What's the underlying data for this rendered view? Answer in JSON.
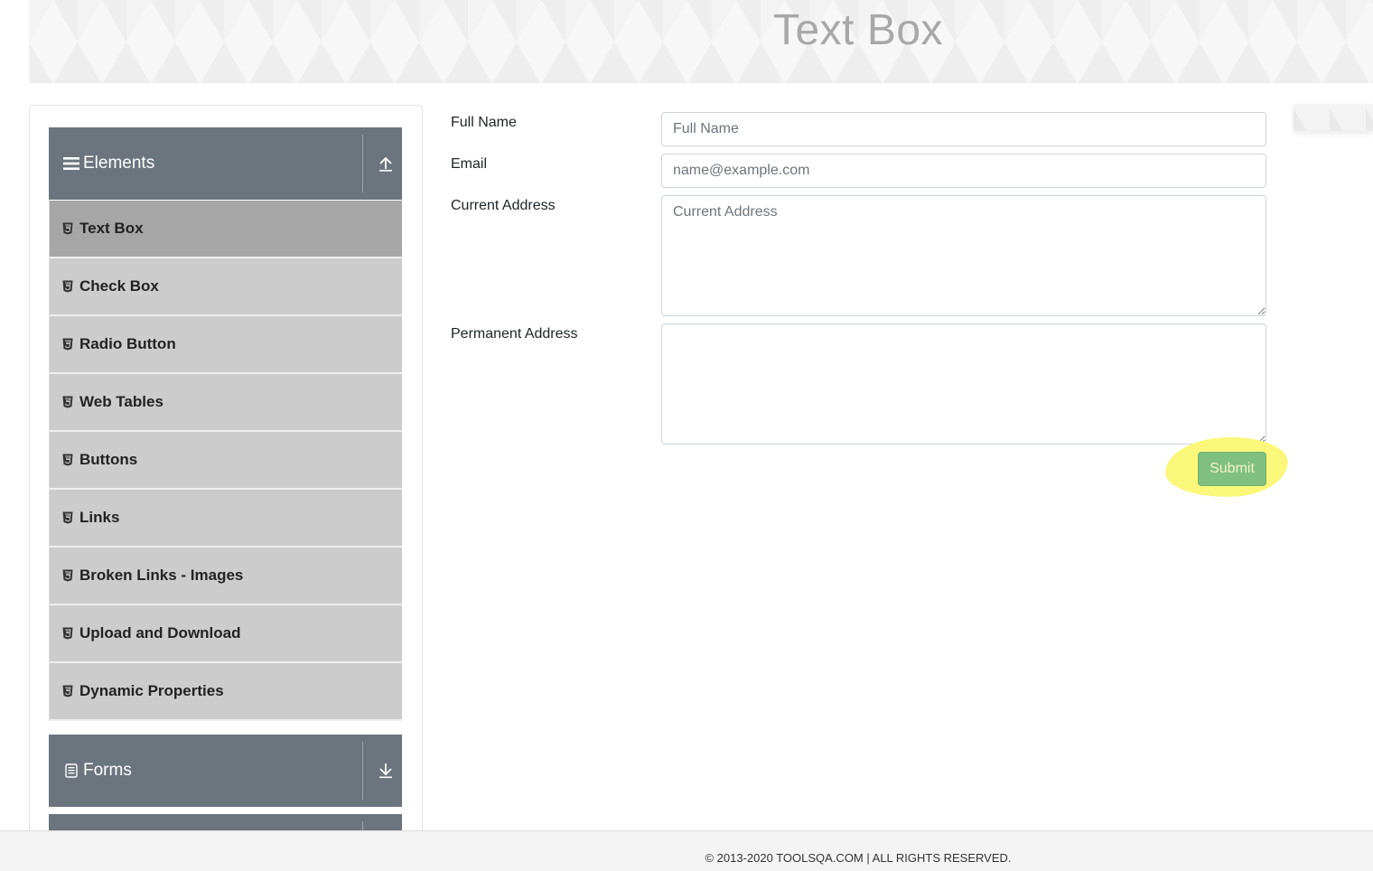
{
  "header": {
    "title": "Text Box"
  },
  "sidebar": {
    "groups": [
      {
        "title": "Elements",
        "icon": "hamburger-icon",
        "arrow": "arrow-up-icon",
        "expanded": true
      },
      {
        "title": "Forms",
        "icon": "document-icon",
        "arrow": "arrow-down-icon",
        "expanded": false
      }
    ],
    "items": [
      {
        "label": "Text Box",
        "icon": "html5-icon",
        "active": true
      },
      {
        "label": "Check Box",
        "icon": "html5-icon"
      },
      {
        "label": "Radio Button",
        "icon": "html5-icon"
      },
      {
        "label": "Web Tables",
        "icon": "html5-icon"
      },
      {
        "label": "Buttons",
        "icon": "html5-icon"
      },
      {
        "label": "Links",
        "icon": "html5-icon"
      },
      {
        "label": "Broken Links - Images",
        "icon": "html5-icon"
      },
      {
        "label": "Upload and Download",
        "icon": "html5-icon"
      },
      {
        "label": "Dynamic Properties",
        "icon": "html5-icon"
      }
    ]
  },
  "form": {
    "full_name": {
      "label": "Full Name",
      "placeholder": "Full Name",
      "value": ""
    },
    "email": {
      "label": "Email",
      "placeholder": "name@example.com",
      "value": ""
    },
    "current_address": {
      "label": "Current Address",
      "placeholder": "Current Address",
      "value": ""
    },
    "permanent_address": {
      "label": "Permanent Address",
      "placeholder": "",
      "value": ""
    },
    "submit_label": "Submit"
  },
  "colors": {
    "group_header": "#6c757d",
    "menu_item": "#cccccc",
    "menu_item_active": "#a6a6a6",
    "submit": "#7fbf7f",
    "highlight": "#fbf77a"
  },
  "footer": {
    "text": "© 2013-2020 TOOLSQA.COM | ALL RIGHTS RESERVED."
  }
}
